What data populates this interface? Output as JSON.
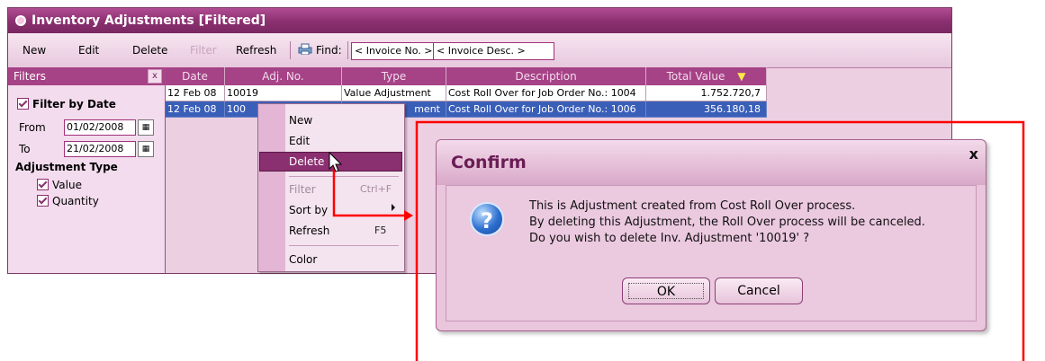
{
  "window": {
    "title": "Inventory Adjustments [Filtered]"
  },
  "toolbar": {
    "new_label": "New",
    "edit_label": "Edit",
    "delete_label": "Delete",
    "filter_label": "Filter",
    "refresh_label": "Refresh",
    "find_label": "Find:",
    "find_field1": "< Invoice No. >",
    "find_field2": "< Invoice Desc. >"
  },
  "filters": {
    "header": "Filters",
    "close": "x",
    "filter_by_date": "Filter by Date",
    "from_label": "From",
    "from_value": "01/02/2008",
    "to_label": "To",
    "to_value": "21/02/2008",
    "adjustment_type_label": "Adjustment Type",
    "options": [
      "Value",
      "Quantity"
    ]
  },
  "table": {
    "columns": [
      "Date",
      "Adj. No.",
      "Type",
      "Description",
      "Total Value"
    ],
    "rows": [
      [
        "12 Feb 08",
        "10019",
        "Value Adjustment",
        "Cost Roll Over for Job Order No.: 1004",
        "1.752.720,7"
      ],
      [
        "12 Feb 08",
        "100",
        "ment",
        "Cost Roll Over for Job Order No.: 1006",
        "356.180,18"
      ]
    ]
  },
  "context_menu": {
    "items": [
      {
        "label": "New",
        "shortcut": ""
      },
      {
        "label": "Edit",
        "shortcut": ""
      },
      {
        "label": "Delete",
        "shortcut": ""
      },
      {
        "label": "Filter",
        "shortcut": "Ctrl+F"
      },
      {
        "label": "Sort by",
        "shortcut": ""
      },
      {
        "label": "Refresh",
        "shortcut": "F5"
      },
      {
        "label": "Color",
        "shortcut": ""
      }
    ]
  },
  "dialog": {
    "title": "Confirm",
    "close": "x",
    "icon": "?",
    "lines": [
      "This is Adjustment created from Cost Roll Over process.",
      "By deleting this Adjustment, the Roll Over process will be canceled.",
      "Do you wish to delete Inv. Adjustment '10019' ?"
    ],
    "ok_label": "OK",
    "cancel_label": "Cancel"
  },
  "colors": {
    "accent": "#8a2f6f",
    "selection": "#3a5fb8",
    "annotation": "#ff0000"
  }
}
